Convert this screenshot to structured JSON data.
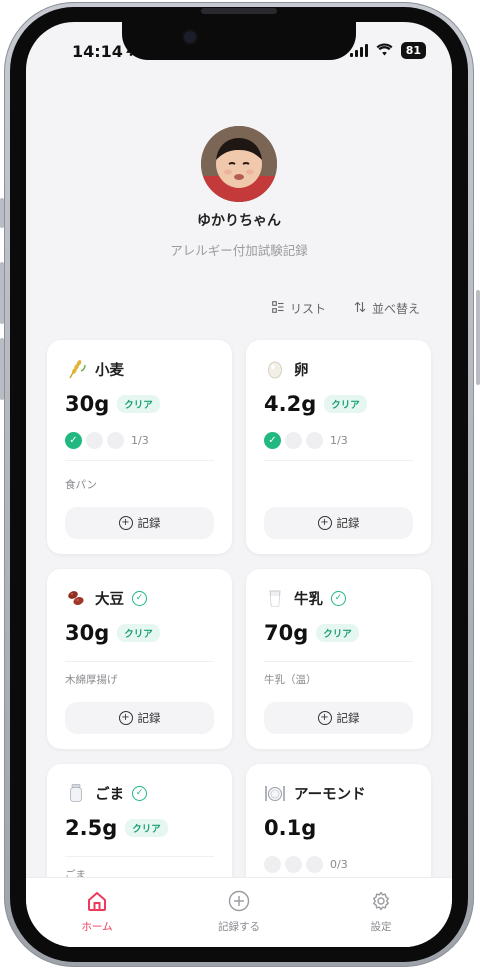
{
  "status_bar": {
    "time": "14:14",
    "battery": "81"
  },
  "profile": {
    "name": "ゆかりちゃん",
    "subtitle": "アレルギー付加試験記録"
  },
  "toolbar": {
    "list_label": "リスト",
    "sort_label": "並べ替え"
  },
  "cards": [
    {
      "name": "小麦",
      "icon": "wheat-icon",
      "amount": "30g",
      "badge": "クリア",
      "progress": "1/3",
      "done": 1,
      "note": "食パン",
      "record_label": "記録"
    },
    {
      "name": "卵",
      "icon": "egg-icon",
      "amount": "4.2g",
      "badge": "クリア",
      "progress": "1/3",
      "done": 1,
      "record_label": "記録"
    },
    {
      "name": "大豆",
      "icon": "beans-icon",
      "amount": "30g",
      "badge": "クリア",
      "completed": true,
      "note": "木綿厚揚げ",
      "record_label": "記録"
    },
    {
      "name": "牛乳",
      "icon": "milk-icon",
      "amount": "70g",
      "badge": "クリア",
      "completed": true,
      "note": "牛乳（温）",
      "record_label": "記録"
    },
    {
      "name": "ごま",
      "icon": "jar-icon",
      "amount": "2.5g",
      "badge": "クリア",
      "completed": true,
      "note": "ごま"
    },
    {
      "name": "アーモンド",
      "icon": "plate-icon",
      "amount": "0.1g",
      "progress": "0/3",
      "done": 0
    }
  ],
  "tabbar": {
    "home": "ホーム",
    "record": "記録する",
    "settings": "設定"
  },
  "colors": {
    "accent": "#ef3a5d",
    "success": "#21b981",
    "background": "#f4f4f6"
  }
}
